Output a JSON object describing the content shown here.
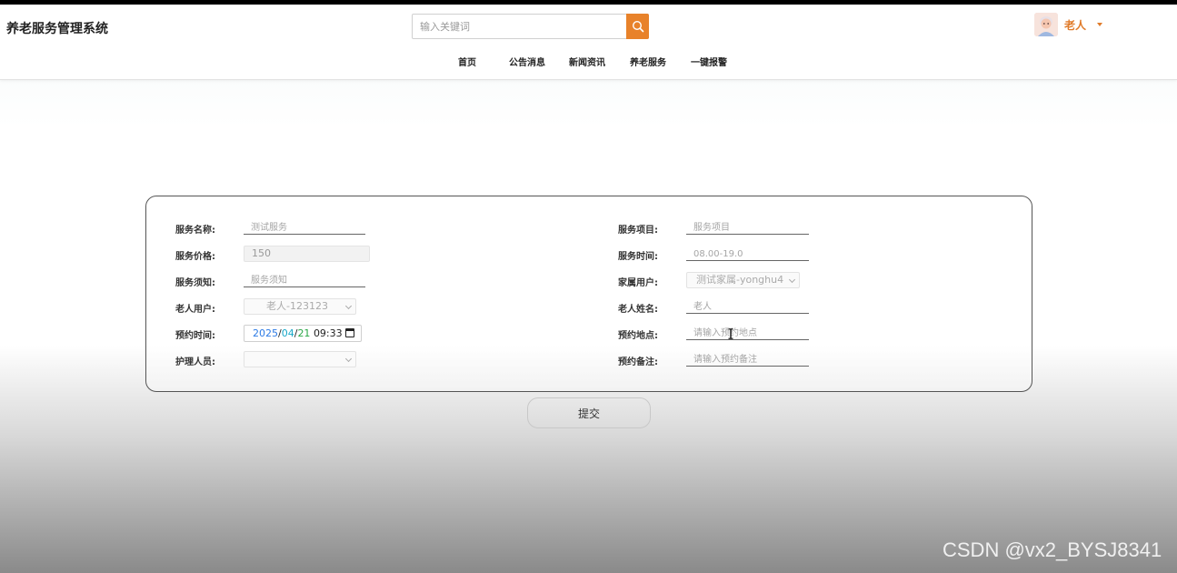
{
  "header": {
    "brand": "养老服务管理系统",
    "search": {
      "placeholder": "输入关键词"
    },
    "user": {
      "name": "老人"
    },
    "nav": [
      "首页",
      "公告消息",
      "新闻资讯",
      "养老服务",
      "一键报警"
    ]
  },
  "form": {
    "left": [
      {
        "label": "服务名称:",
        "kind": "underline",
        "placeholder": "测试服务"
      },
      {
        "label": "服务价格:",
        "kind": "readonly",
        "value": "150"
      },
      {
        "label": "服务须知:",
        "kind": "underline",
        "placeholder": "服务须知"
      },
      {
        "label": "老人用户:",
        "kind": "select",
        "value": "老人-123123"
      },
      {
        "label": "预约时间:",
        "kind": "datetime",
        "year": "2025",
        "month": "04",
        "day": "21",
        "time": "09:33"
      },
      {
        "label": "护理人员:",
        "kind": "select",
        "value": ""
      }
    ],
    "right": [
      {
        "label": "服务项目:",
        "kind": "underline",
        "placeholder": "服务项目"
      },
      {
        "label": "服务时间:",
        "kind": "underline",
        "placeholder": "08.00-19.0"
      },
      {
        "label": "家属用户:",
        "kind": "select",
        "value": "测试家属-yonghu4"
      },
      {
        "label": "老人姓名:",
        "kind": "underline",
        "placeholder": "老人"
      },
      {
        "label": "预约地点:",
        "kind": "underline",
        "placeholder": "请输入预约地点"
      },
      {
        "label": "预约备注:",
        "kind": "underline",
        "placeholder": "请输入预约备注"
      }
    ],
    "submit_label": "提交"
  },
  "watermark": "CSDN @vx2_BYSJ8341",
  "colors": {
    "accent": "#e8822a",
    "user_name": "#e07b2a"
  }
}
